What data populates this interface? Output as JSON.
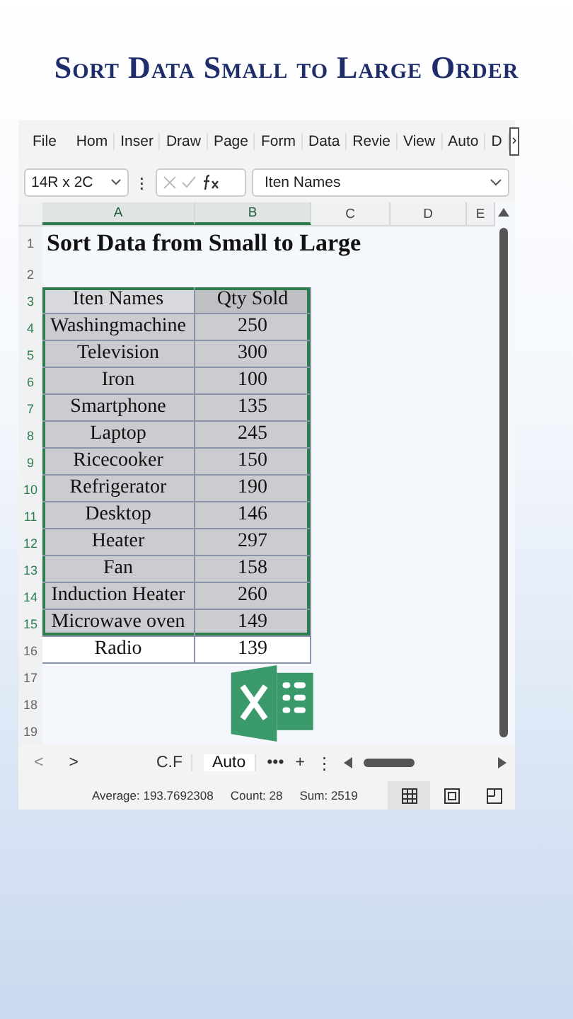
{
  "heading": "Sort Data Small to Large Order",
  "ribbon": {
    "tabs": [
      {
        "label": "File"
      },
      {
        "label": "Hom"
      },
      {
        "label": "Inser"
      },
      {
        "label": "Draw"
      },
      {
        "label": "Page"
      },
      {
        "label": "Form"
      },
      {
        "label": "Data"
      },
      {
        "label": "Revie"
      },
      {
        "label": "View"
      },
      {
        "label": "Auto"
      },
      {
        "label": "D"
      }
    ],
    "more": "›"
  },
  "formula_bar": {
    "name_box": "14R x 2C",
    "menu": "⋮",
    "value": "Iten Names"
  },
  "columns": [
    {
      "label": "A",
      "selected": true
    },
    {
      "label": "B",
      "selected": true
    },
    {
      "label": "C",
      "selected": false
    },
    {
      "label": "D",
      "selected": false
    },
    {
      "label": "E",
      "selected": false
    }
  ],
  "rows": [
    {
      "row": "1",
      "kind": "title",
      "text": "Sort Data from Small to Large",
      "selected": false
    },
    {
      "row": "2",
      "kind": "empty",
      "selected": false
    },
    {
      "row": "3",
      "kind": "header",
      "cells": [
        "Iten Names",
        "Qty Sold"
      ],
      "selected": true
    },
    {
      "row": "4",
      "kind": "data",
      "cells": [
        "Washingmachine",
        "250"
      ],
      "selected": true
    },
    {
      "row": "5",
      "kind": "data",
      "cells": [
        "Television",
        "300"
      ],
      "selected": true
    },
    {
      "row": "6",
      "kind": "data",
      "cells": [
        "Iron",
        "100"
      ],
      "selected": true
    },
    {
      "row": "7",
      "kind": "data",
      "cells": [
        "Smartphone",
        "135"
      ],
      "selected": true
    },
    {
      "row": "8",
      "kind": "data",
      "cells": [
        "Laptop",
        "245"
      ],
      "selected": true
    },
    {
      "row": "9",
      "kind": "data",
      "cells": [
        "Ricecooker",
        "150"
      ],
      "selected": true
    },
    {
      "row": "10",
      "kind": "data",
      "cells": [
        "Refrigerator",
        "190"
      ],
      "selected": true
    },
    {
      "row": "11",
      "kind": "data",
      "cells": [
        "Desktop",
        "146"
      ],
      "selected": true
    },
    {
      "row": "12",
      "kind": "data",
      "cells": [
        "Heater",
        "297"
      ],
      "selected": true
    },
    {
      "row": "13",
      "kind": "data",
      "cells": [
        "Fan",
        "158"
      ],
      "selected": true
    },
    {
      "row": "14",
      "kind": "data",
      "cells": [
        "Induction Heater",
        "260"
      ],
      "selected": true
    },
    {
      "row": "15",
      "kind": "data",
      "cells": [
        "Microwave oven",
        "149"
      ],
      "selected": true
    },
    {
      "row": "16",
      "kind": "data",
      "cells": [
        "Radio",
        "139"
      ],
      "selected": false
    },
    {
      "row": "17",
      "kind": "empty",
      "selected": false
    },
    {
      "row": "18",
      "kind": "empty",
      "selected": false
    },
    {
      "row": "19",
      "kind": "empty",
      "selected": false
    }
  ],
  "sheet_bar": {
    "prev": "<",
    "next": ">",
    "sheets": [
      {
        "label": "C.F",
        "selected": false
      },
      {
        "label": "Auto",
        "selected": true
      }
    ],
    "more": "•••",
    "add": "+",
    "menu": "⋮"
  },
  "status_bar": {
    "average": "Average: 193.7692308",
    "count": "Count: 28",
    "sum": "Sum: 2519"
  }
}
